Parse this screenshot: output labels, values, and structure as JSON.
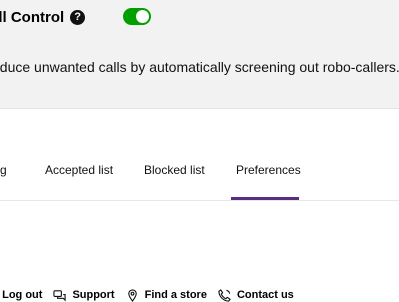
{
  "header": {
    "title": "all Control",
    "help_symbol": "?",
    "toggle_state": "on",
    "description": "educe unwanted calls by automatically screening out robo-callers."
  },
  "tabs": [
    {
      "label": "g"
    },
    {
      "label": "Accepted list"
    },
    {
      "label": "Blocked list"
    },
    {
      "label": "Preferences",
      "active": true
    }
  ],
  "footer": {
    "account_link": ", Log out",
    "support_label": "Support",
    "store_label": "Find a store",
    "contact_label": "Contact us"
  },
  "colors": {
    "toggle_on": "#00a000",
    "active_tab": "#5a2d82",
    "panel_bg": "#f2f2f2"
  },
  "icons": [
    "help-icon",
    "chat-icon",
    "location-pin-icon",
    "phone-icon"
  ]
}
